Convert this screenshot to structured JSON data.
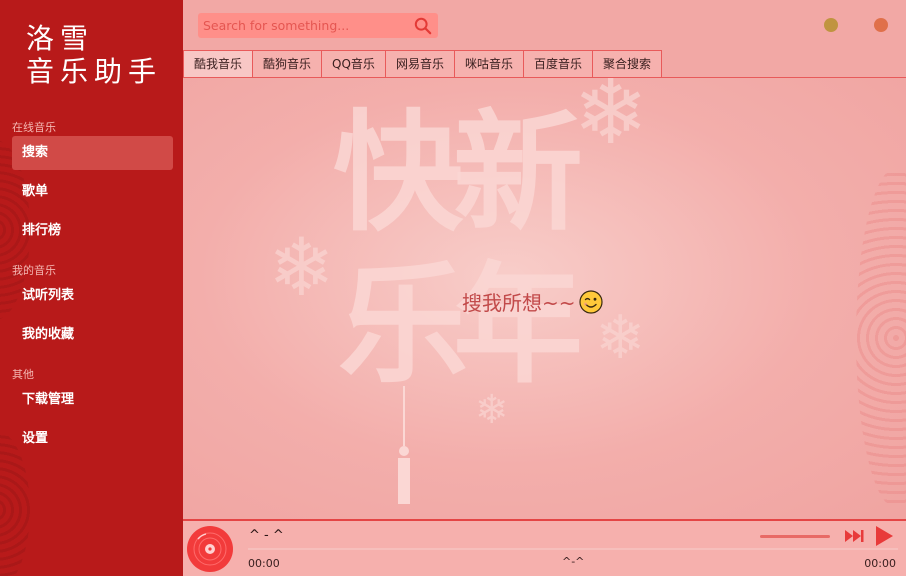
{
  "app": {
    "logo_line1": "洛雪",
    "logo_line2": "音乐助手"
  },
  "sidebar": {
    "groups": [
      {
        "label": "在线音乐"
      },
      {
        "label": "我的音乐"
      },
      {
        "label": "其他"
      }
    ],
    "items": [
      {
        "label": "搜索",
        "active": true
      },
      {
        "label": "歌单"
      },
      {
        "label": "排行榜"
      },
      {
        "label": "试听列表"
      },
      {
        "label": "我的收藏"
      },
      {
        "label": "下载管理"
      },
      {
        "label": "设置"
      }
    ]
  },
  "search": {
    "placeholder": "Search for something...",
    "value": "",
    "icon": "search-icon"
  },
  "window_controls": {
    "minimize_color": "#c09440",
    "close_color": "#e0704a"
  },
  "tabs": [
    {
      "label": "酷我音乐",
      "active": true
    },
    {
      "label": "酷狗音乐"
    },
    {
      "label": "QQ音乐"
    },
    {
      "label": "网易音乐"
    },
    {
      "label": "咪咕音乐"
    },
    {
      "label": "百度音乐"
    },
    {
      "label": "聚合搜索"
    }
  ],
  "main": {
    "hint_text": "搜我所想~~",
    "hint_emoji": "winking-face-icon",
    "background_chars": [
      "快",
      "新",
      "乐",
      "年"
    ]
  },
  "player": {
    "song_title": "^ - ^",
    "artist": "^-^",
    "time_current": "00:00",
    "time_total": "00:00",
    "progress": 0,
    "accent_color": "#e44545"
  },
  "colors": {
    "sidebar_bg": "#b81a1a",
    "main_bg": "#f2a8a5",
    "accent": "#e44545"
  }
}
